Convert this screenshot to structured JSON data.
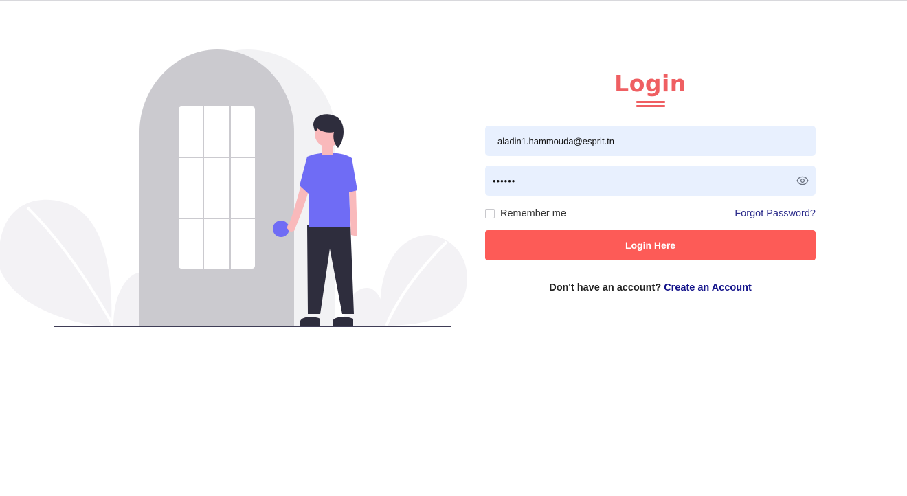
{
  "colors": {
    "accent": "#ef5f62",
    "button": "#fd5b57",
    "field_background": "#e8f0fe",
    "link": "#13138a",
    "illustration_door": "#cbcacf",
    "illustration_shirt": "#6f6cf5",
    "illustration_pants": "#2e2d3d"
  },
  "login": {
    "title": "Login",
    "email_value": "aladin1.hammouda@esprit.tn",
    "password_value": "••••••",
    "password_icon": "eye-icon",
    "remember_label": "Remember me",
    "forgot_label": "Forgot Password?",
    "submit_label": "Login Here",
    "no_account_text": "Don't have an account?",
    "create_account_label": "Create an Account"
  }
}
